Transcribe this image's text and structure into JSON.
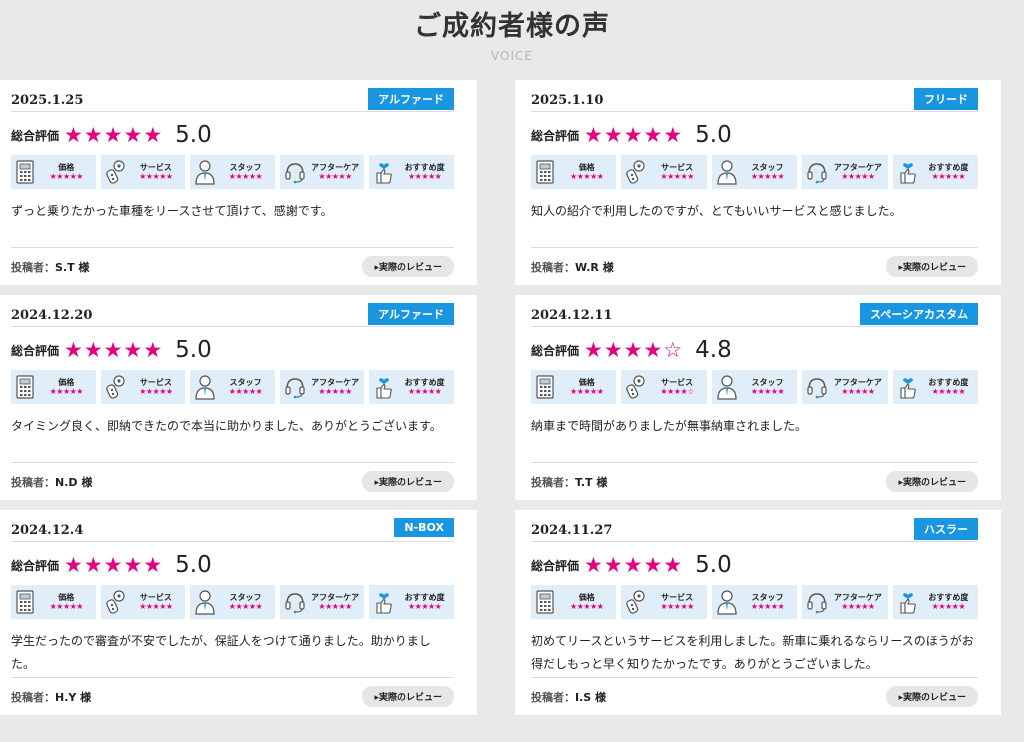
{
  "header": {
    "title": "ご成約者様の声",
    "subtitle": "VOICE"
  },
  "labels": {
    "overall": "総合評価",
    "poster": "投稿者：",
    "review_button": "▸実際のレビュー",
    "categories": [
      "価格",
      "サービス",
      "スタッフ",
      "アフターケア",
      "おすすめ度"
    ]
  },
  "colors": {
    "accent_pink": "#e5007f",
    "badge_blue": "#1a96e0",
    "category_bg": "#dfeef8"
  },
  "reviews": [
    {
      "date": "2025.1.25",
      "car": "アルファード",
      "stars": "★★★★★",
      "score": "5.0",
      "cat_stars": [
        "★★★★★",
        "★★★★★",
        "★★★★★",
        "★★★★★",
        "★★★★★"
      ],
      "comment": "ずっと乗りたかった車種をリースさせて頂けて、感謝です。",
      "poster": "S.T 様"
    },
    {
      "date": "2025.1.10",
      "car": "フリード",
      "stars": "★★★★★",
      "score": "5.0",
      "cat_stars": [
        "★★★★★",
        "★★★★★",
        "★★★★★",
        "★★★★★",
        "★★★★★"
      ],
      "comment": "知人の紹介で利用したのですが、とてもいいサービスと感じました。",
      "poster": "W.R 様"
    },
    {
      "date": "2024.12.20",
      "car": "アルファード",
      "stars": "★★★★★",
      "score": "5.0",
      "cat_stars": [
        "★★★★★",
        "★★★★★",
        "★★★★★",
        "★★★★★",
        "★★★★★"
      ],
      "comment": "タイミング良く、即納できたので本当に助かりました、ありがとうございます。",
      "poster": "N.D 様"
    },
    {
      "date": "2024.12.11",
      "car": "スペーシアカスタム",
      "stars": "★★★★☆",
      "score": "4.8",
      "cat_stars": [
        "★★★★★",
        "★★★★☆",
        "★★★★★",
        "★★★★★",
        "★★★★★"
      ],
      "comment": "納車まで時間がありましたが無事納車されました。",
      "poster": "T.T 様"
    },
    {
      "date": "2024.12.4",
      "car": "N-BOX",
      "stars": "★★★★★",
      "score": "5.0",
      "cat_stars": [
        "★★★★★",
        "★★★★★",
        "★★★★★",
        "★★★★★",
        "★★★★★"
      ],
      "comment": "学生だったので審査が不安でしたが、保証人をつけて通りました。助かりました。",
      "poster": "H.Y 様"
    },
    {
      "date": "2024.11.27",
      "car": "ハスラー",
      "stars": "★★★★★",
      "score": "5.0",
      "cat_stars": [
        "★★★★★",
        "★★★★★",
        "★★★★★",
        "★★★★★",
        "★★★★★"
      ],
      "comment": "初めてリースというサービスを利用しました。新車に乗れるならリースのほうがお得だしもっと早く知りたかったです。ありがとうございました。",
      "poster": "I.S 様"
    }
  ]
}
